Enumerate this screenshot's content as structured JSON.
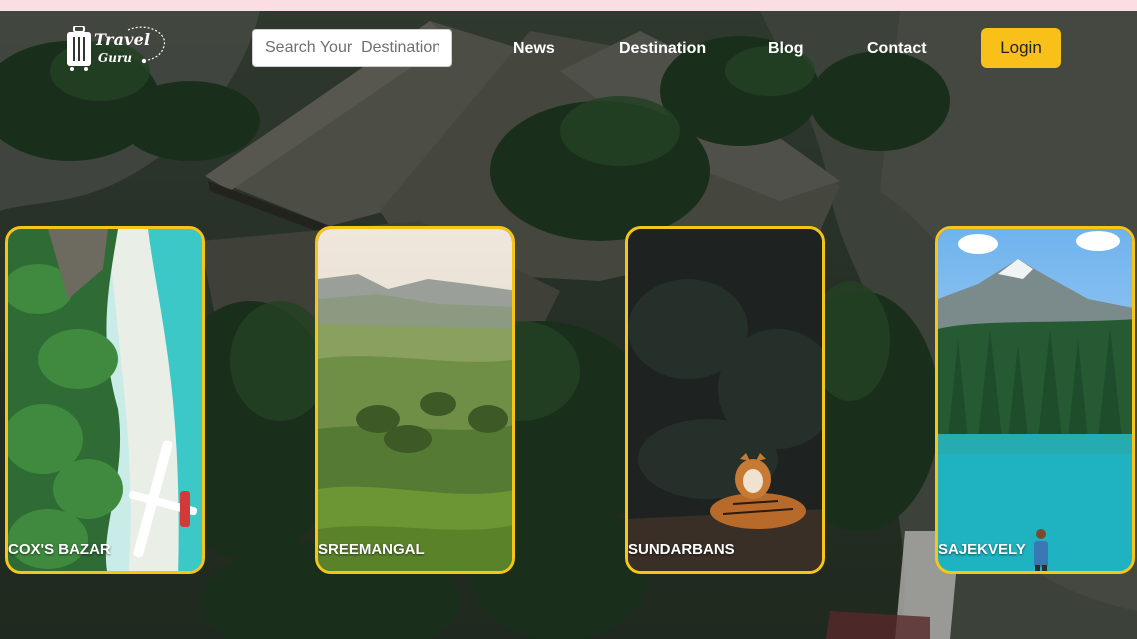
{
  "brand": {
    "line1": "Travel",
    "line2": "Guru"
  },
  "search": {
    "placeholder": "Search Your  Destination"
  },
  "nav": {
    "news": "News",
    "destination": "Destination",
    "blog": "Blog",
    "contact": "Contact"
  },
  "login": {
    "label": "Login"
  },
  "cards": [
    {
      "name": "COX'S BAZAR"
    },
    {
      "name": "SREEMANGAL"
    },
    {
      "name": "SUNDARBANS"
    },
    {
      "name": "SAJEKVELY"
    }
  ],
  "colors": {
    "accent": "#f9c01a",
    "card_border": "#f5c518",
    "nav_text": "#ffffff"
  }
}
